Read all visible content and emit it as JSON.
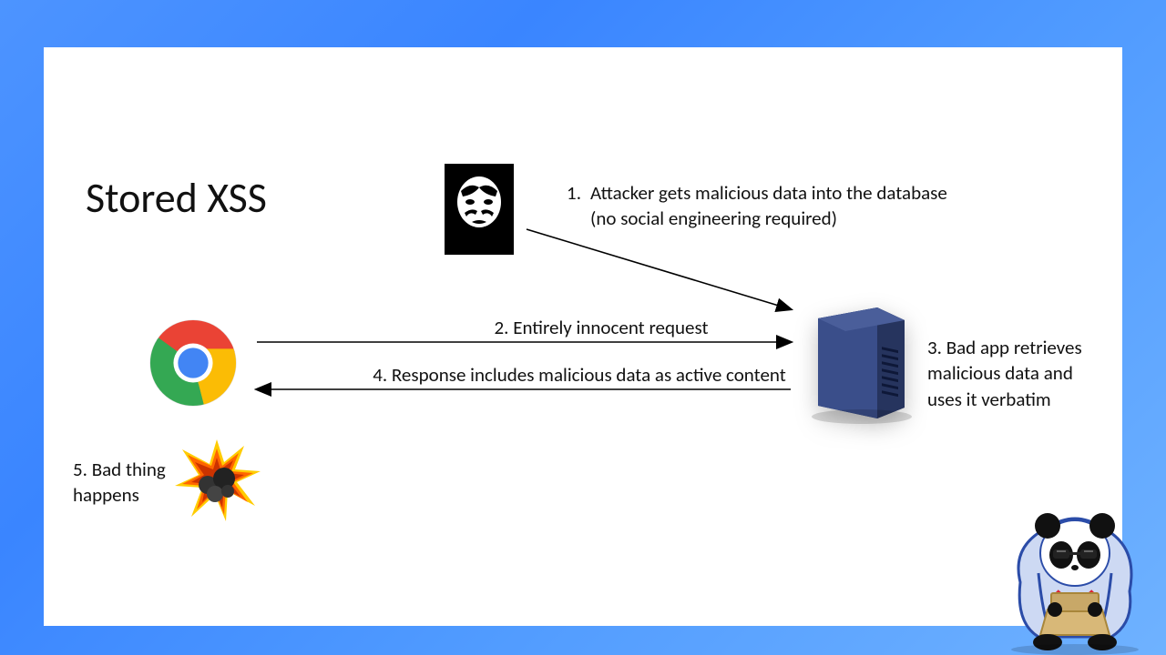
{
  "title": "Stored XSS",
  "steps": {
    "s1_num": "1.",
    "s1_txt": "Attacker gets malicious data into the database (no social engineering required)",
    "s2": "2. Entirely innocent request",
    "s3": "3. Bad app retrieves malicious data and uses it verbatim",
    "s4": "4. Response includes malicious data as active content",
    "s5": "5. Bad thing happens"
  },
  "icons": {
    "attacker": "guy-fawkes-mask",
    "browser": "chrome",
    "server": "server",
    "explosion": "explosion",
    "mascot": "hacker-panda"
  }
}
